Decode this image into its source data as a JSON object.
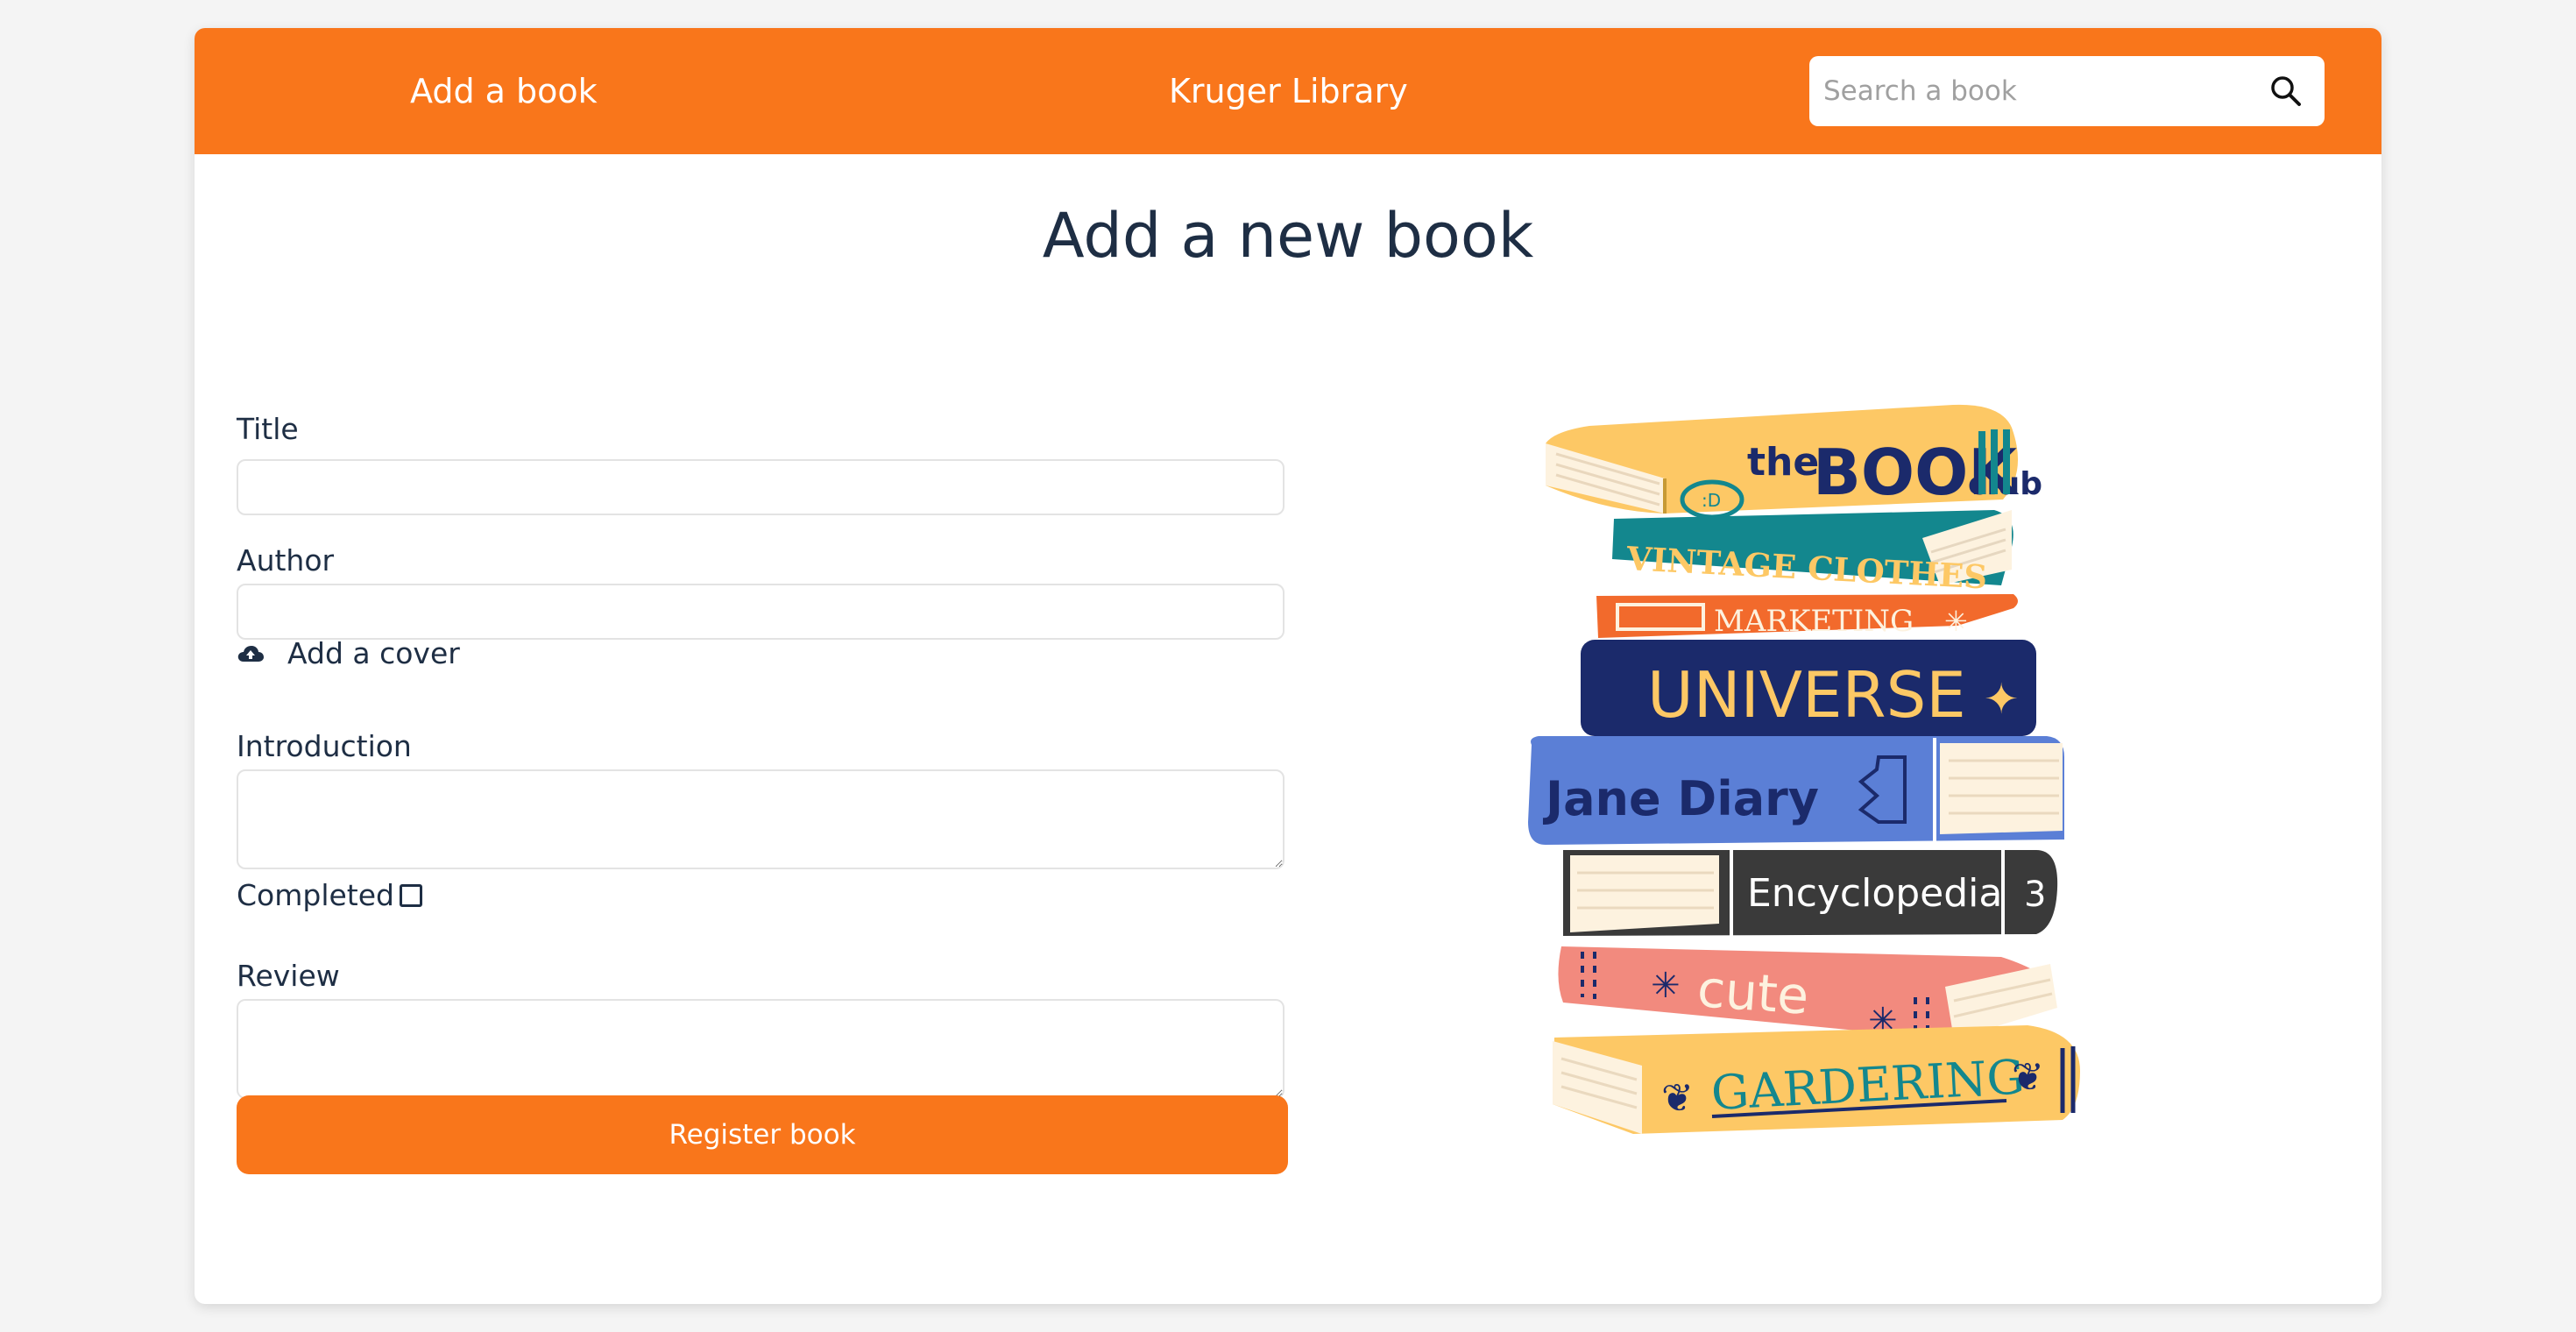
{
  "navbar": {
    "add_link": "Add a book",
    "brand": "Kruger Library",
    "search_placeholder": "Search a book"
  },
  "page": {
    "title": "Add a new book"
  },
  "form": {
    "title_label": "Title",
    "author_label": "Author",
    "cover_label": "Add a cover",
    "introduction_label": "Introduction",
    "completed_label": "Completed",
    "completed_checked": false,
    "review_label": "Review",
    "submit_label": "Register book"
  },
  "illustration": {
    "books": [
      {
        "spine_text": "theBOOKclub",
        "color": "#fdc865"
      },
      {
        "spine_text": "VINTAGE CLOTHES",
        "color": "#13878e"
      },
      {
        "spine_text": "MARKETING",
        "color": "#f26a2c"
      },
      {
        "spine_text": "UNIVERSE",
        "color": "#1b2a6b"
      },
      {
        "spine_text": "Jane Diary",
        "color": "#5b7fd6"
      },
      {
        "spine_text": "Encyclopedia",
        "color": "#3a3a3a"
      },
      {
        "spine_text": "cute",
        "color": "#f28a7e"
      },
      {
        "spine_text": "GARDERING",
        "color": "#fdc865"
      }
    ],
    "volume_number": "3"
  },
  "colors": {
    "accent": "#f9761b",
    "text": "#1e2e44",
    "background": "#f4f4f4"
  }
}
